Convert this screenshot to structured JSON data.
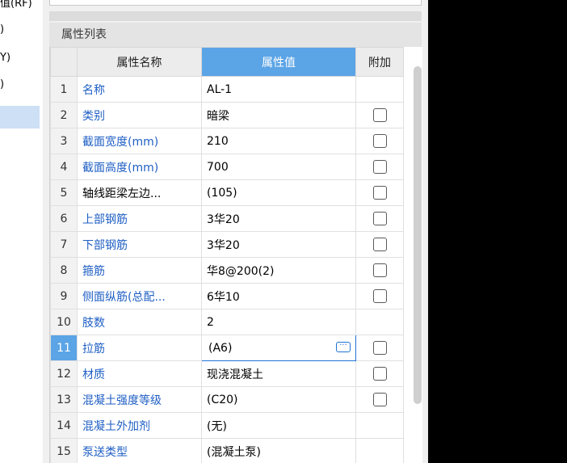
{
  "left_tree": {
    "items": [
      "值(RF)",
      ")",
      "Y)",
      ")"
    ]
  },
  "panel": {
    "title": "属性列表",
    "columns": {
      "index": "",
      "name": "属性名称",
      "value": "属性值",
      "add": "附加"
    },
    "rows": [
      {
        "index": "1",
        "name": "名称",
        "value": "AL-1",
        "checkbox": false
      },
      {
        "index": "2",
        "name": "类别",
        "value": "暗梁",
        "checkbox": true
      },
      {
        "index": "3",
        "name": "截面宽度(mm)",
        "value": "210",
        "checkbox": true
      },
      {
        "index": "4",
        "name": "截面高度(mm)",
        "value": "700",
        "checkbox": true
      },
      {
        "index": "5",
        "name": "轴线距梁左边...",
        "value": "(105)",
        "checkbox": true
      },
      {
        "index": "6",
        "name": "上部钢筋",
        "value": "3华20",
        "checkbox": true
      },
      {
        "index": "7",
        "name": "下部钢筋",
        "value": "3华20",
        "checkbox": true
      },
      {
        "index": "8",
        "name": "箍筋",
        "value": "华8@200(2)",
        "checkbox": true
      },
      {
        "index": "9",
        "name": "侧面纵筋(总配...",
        "value": "6华10",
        "checkbox": true
      },
      {
        "index": "10",
        "name": "肢数",
        "value": "2",
        "checkbox": false
      },
      {
        "index": "11",
        "name": "拉筋",
        "value": "(A6)",
        "checkbox": true
      },
      {
        "index": "12",
        "name": "材质",
        "value": "现浇混凝土",
        "checkbox": true
      },
      {
        "index": "13",
        "name": "混凝土强度等级",
        "value": "(C20)",
        "checkbox": true
      },
      {
        "index": "14",
        "name": "混凝土外加剂",
        "value": "(无)",
        "checkbox": false
      },
      {
        "index": "15",
        "name": "泵送类型",
        "value": "(混凝土泵)",
        "checkbox": false
      }
    ],
    "selected_row": "11",
    "edit_button_label": "···"
  },
  "colors": {
    "accent": "#5ba4e6",
    "link_text": "#1f5fc4",
    "selection_left": "#cde0f5"
  }
}
